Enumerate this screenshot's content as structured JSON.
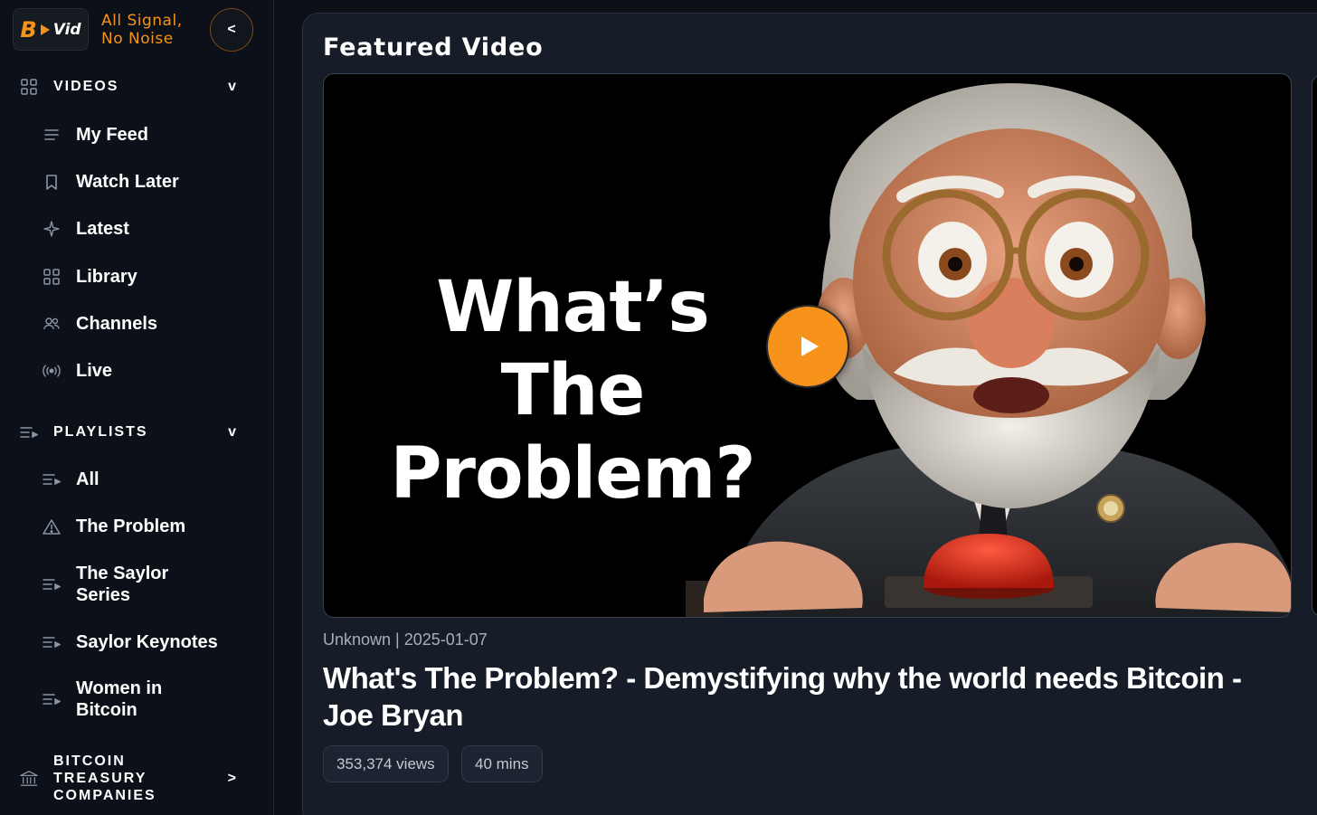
{
  "brand": {
    "logo_b": "B",
    "logo_vid": "Vid",
    "tagline_line1": "All Signal,",
    "tagline_line2": "No Noise",
    "collapse_label": "<"
  },
  "sidebar": {
    "videos": {
      "title": "VIDEOS",
      "chevron": "v",
      "items": [
        {
          "label": "My Feed",
          "icon": "feed-icon"
        },
        {
          "label": "Watch Later",
          "icon": "bookmark-icon"
        },
        {
          "label": "Latest",
          "icon": "sparkle-icon"
        },
        {
          "label": "Library",
          "icon": "grid-icon"
        },
        {
          "label": "Channels",
          "icon": "users-icon"
        },
        {
          "label": "Live",
          "icon": "broadcast-icon"
        }
      ]
    },
    "playlists": {
      "title": "PLAYLISTS",
      "chevron": "v",
      "items": [
        {
          "label": "All",
          "icon": "playlist-icon"
        },
        {
          "label": "The Problem",
          "icon": "warning-icon"
        },
        {
          "label": "The Saylor Series",
          "line1": "The Saylor",
          "line2": "Series",
          "icon": "playlist-icon"
        },
        {
          "label": "Saylor Keynotes",
          "icon": "playlist-icon"
        },
        {
          "label": "Women in Bitcoin",
          "line1": "Women in",
          "line2": "Bitcoin",
          "icon": "playlist-icon"
        }
      ]
    },
    "treasury": {
      "line1": "BITCOIN",
      "line2": "TREASURY",
      "line3": "COMPANIES",
      "chevron": ">"
    }
  },
  "main": {
    "section_title": "Featured Video",
    "thumbnail_text_line1": "What’s The",
    "thumbnail_text_line2": "Problem?",
    "meta": "Unknown | 2025-01-07",
    "title": "What's The Problem? - Demystifying why the world needs Bitcoin - Joe Bryan",
    "views": "353,374 views",
    "duration": "40 mins"
  },
  "colors": {
    "accent": "#f7931a",
    "background": "#0d1117",
    "card": "#161c28",
    "muted_text": "#a7afbd"
  }
}
